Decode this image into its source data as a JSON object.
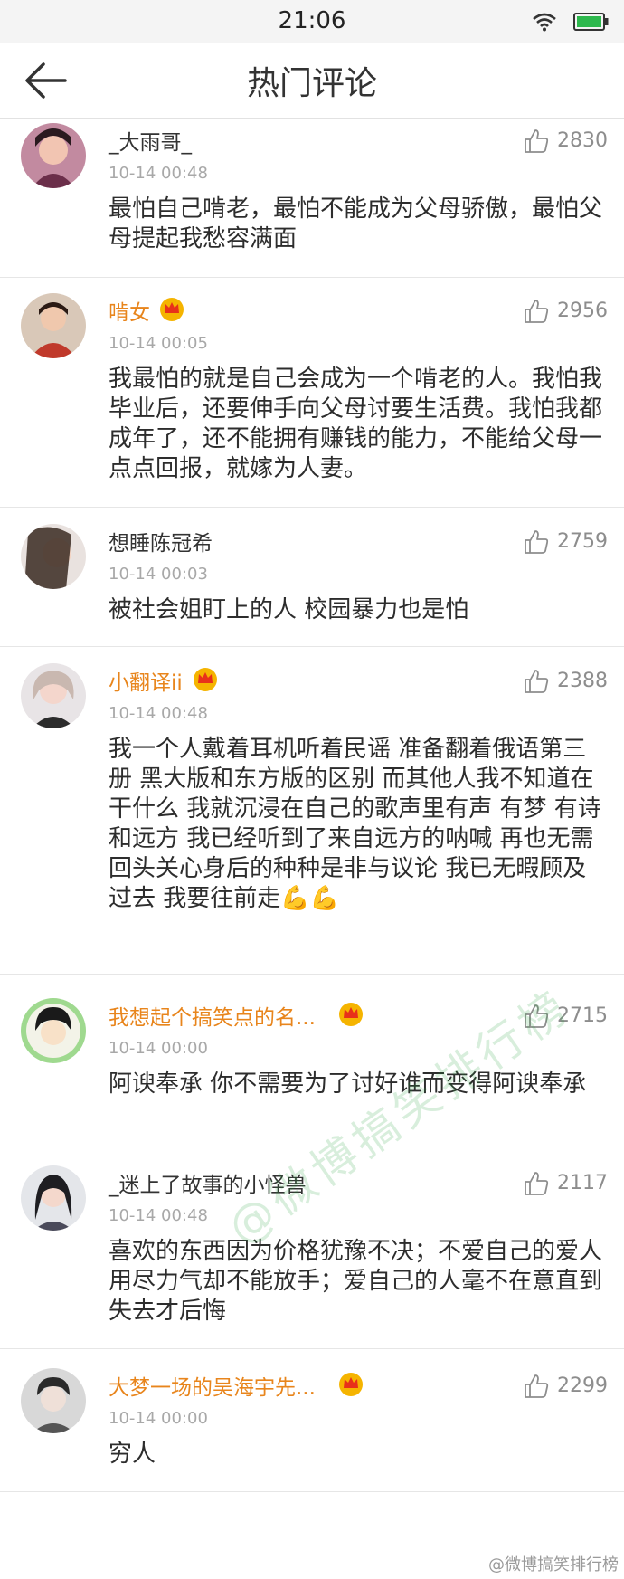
{
  "status_bar": {
    "time": "21:06"
  },
  "header": {
    "title": "热门评论"
  },
  "comments": [
    {
      "username": "_大雨哥_",
      "time": "10-14 00:48",
      "likes": "2830",
      "vip": false,
      "text": "最怕自己啃老，最怕不能成为父母骄傲，最怕父母提起我愁容满面"
    },
    {
      "username": "啃女",
      "time": "10-14 00:05",
      "likes": "2956",
      "vip": true,
      "text": "我最怕的就是自己会成为一个啃老的人。我怕我毕业后，还要伸手向父母讨要生活费。我怕我都成年了，还不能拥有赚钱的能力，不能给父母一点点回报，就嫁为人妻。"
    },
    {
      "username": "想睡陈冠希",
      "time": "10-14 00:03",
      "likes": "2759",
      "vip": false,
      "text": "被社会姐盯上的人 校园暴力也是怕"
    },
    {
      "username": "小翻译ii",
      "time": "10-14 00:48",
      "likes": "2388",
      "vip": true,
      "text": "我一个人戴着耳机听着民谣 准备翻着俄语第三册 黑大版和东方版的区别 而其他人我不知道在干什么 我就沉浸在自己的歌声里有声 有梦 有诗和远方 我已经听到了来自远方的呐喊 再也无需回头关心身后的种种是非与议论 我已无暇顾及过去 我要往前走💪💪"
    },
    {
      "username": "我想起个搞笑点的名...",
      "time": "10-14 00:00",
      "likes": "2715",
      "vip": true,
      "text": "阿谀奉承 你不需要为了讨好谁而变得阿谀奉承"
    },
    {
      "username": "_迷上了故事的小怪兽",
      "time": "10-14 00:48",
      "likes": "2117",
      "vip": false,
      "text": "喜欢的东西因为价格犹豫不决；不爱自己的爱人用尽力气却不能放手；爱自己的人毫不在意直到失去才后悔"
    },
    {
      "username": "大梦一场的吴海宇先...",
      "time": "10-14 00:00",
      "likes": "2299",
      "vip": true,
      "text": "穷人"
    }
  ],
  "watermark": {
    "diagonal": "@微博搞笑排行榜",
    "corner": "@微博搞笑排行榜"
  },
  "colors": {
    "vip_name": "#e8851c",
    "normal_name": "#333333",
    "muted": "#a8a8a8",
    "battery": "#2db84d"
  },
  "icons": {
    "back": "arrow-left-icon",
    "like": "thumbs-up-icon",
    "vip": "crown-badge-icon",
    "wifi": "wifi-icon",
    "battery": "battery-icon"
  }
}
